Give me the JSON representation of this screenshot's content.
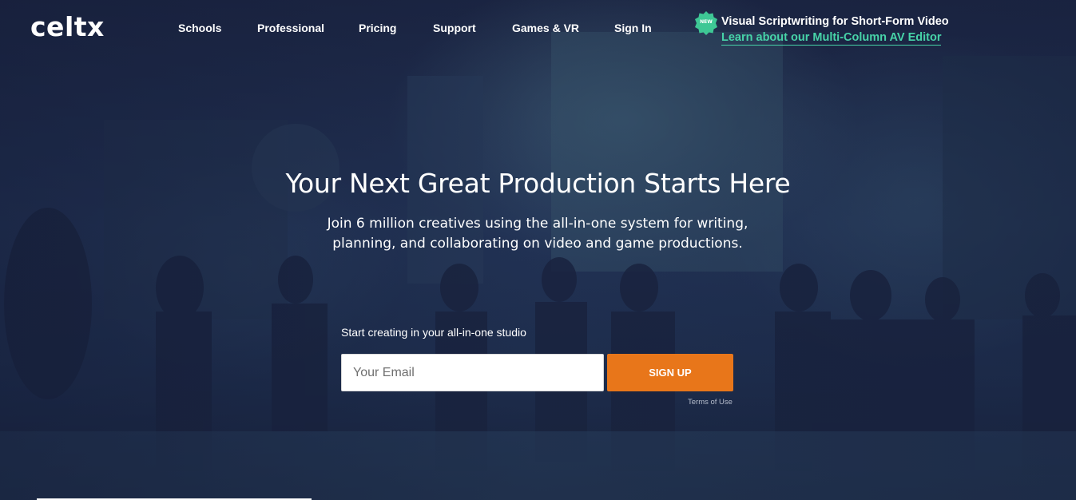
{
  "brand": {
    "logo_text": "celtx"
  },
  "nav": {
    "items": [
      {
        "label": "Schools"
      },
      {
        "label": "Professional"
      },
      {
        "label": "Pricing"
      },
      {
        "label": "Support"
      },
      {
        "label": "Games & VR"
      },
      {
        "label": "Sign In"
      }
    ]
  },
  "announcement": {
    "badge": "NEW",
    "title": "Visual Scriptwriting for Short-Form Video",
    "link_text": "Learn about our Multi-Column AV Editor"
  },
  "hero": {
    "headline": "Your Next Great Production Starts Here",
    "subhead": "Join 6 million creatives using the all-in-one system for writing, planning, and collaborating on video and game productions."
  },
  "signup": {
    "label": "Start creating in your all-in-one studio",
    "email_placeholder": "Your Email",
    "email_value": "",
    "button_label": "SIGN UP",
    "terms_link": "Terms of Use"
  },
  "colors": {
    "accent_orange": "#e8761a",
    "accent_teal": "#47d3a8",
    "overlay_navy": "#1c2644"
  },
  "icons": {
    "new_badge": "new-badge-icon"
  }
}
